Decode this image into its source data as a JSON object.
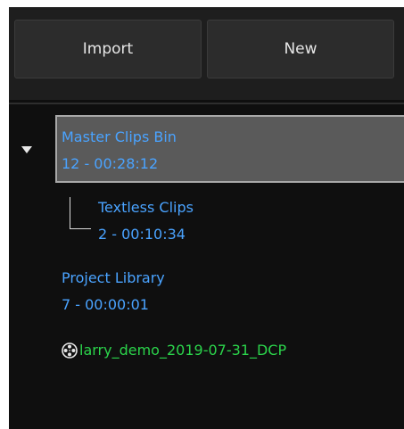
{
  "toolbar": {
    "import_label": "Import",
    "new_label": "New"
  },
  "bins": [
    {
      "name": "Master Clips Bin",
      "summary": "12 - 00:28:12",
      "selected": true,
      "expanded": true
    },
    {
      "name": "Textless Clips",
      "summary": "2 - 00:10:34",
      "selected": false
    },
    {
      "name": "Project Library",
      "summary": "7 - 00:00:01",
      "selected": false
    }
  ],
  "dcp": {
    "icon": "film-reel-icon",
    "name": "larry_demo_2019-07-31_DCP"
  },
  "colors": {
    "bin_text": "#4aa3ff",
    "dcp_text": "#2bd44b",
    "selected_bg": "#5a5a5a",
    "panel_bg": "#0f0f0f"
  }
}
